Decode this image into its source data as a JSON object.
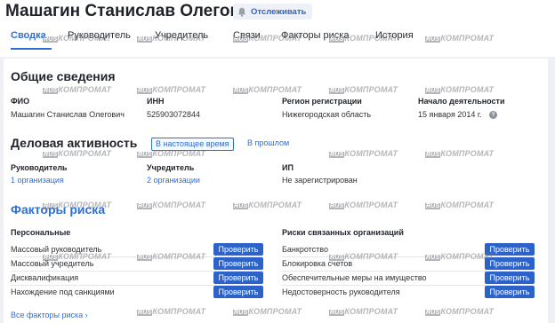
{
  "header": {
    "title": "Машагин Станислав Олегович",
    "track_label": "Отслеживать"
  },
  "tabs": [
    {
      "label": "Сводка",
      "active": true
    },
    {
      "label": "Руководитель",
      "active": false
    },
    {
      "label": "Учредитель",
      "active": false
    },
    {
      "label": "Связи",
      "active": false
    },
    {
      "label": "Факторы риска",
      "active": false
    },
    {
      "label": "История",
      "active": false
    }
  ],
  "general": {
    "heading": "Общие сведения",
    "fio_label": "ФИО",
    "fio_value": "Машагин Станислав Олегович",
    "inn_label": "ИНН",
    "inn_value": "525903072844",
    "region_label": "Регион регистрации",
    "region_value": "Нижегородская область",
    "start_label": "Начало деятельности",
    "start_value": "15 января 2014 г."
  },
  "activity": {
    "heading": "Деловая активность",
    "toggle_now": "В настоящее время",
    "toggle_past": "В прошлом",
    "director_label": "Руководитель",
    "director_value": "1 организация",
    "founder_label": "Учредитель",
    "founder_value": "2 организации",
    "ip_label": "ИП",
    "ip_value": "Не зарегистрирован"
  },
  "risks": {
    "heading": "Факторы риска",
    "personal_label": "Персональные",
    "related_label": "Риски связанных организаций",
    "check_label": "Проверить",
    "personal": [
      "Массовый руководитель",
      "Массовый учредитель",
      "Дисквалификация",
      "Нахождение под санкциями"
    ],
    "related": [
      "Банкротство",
      "Блокировка счетов",
      "Обеспечительные меры на имущество",
      "Недостоверность руководителя"
    ],
    "all_link": "Все факторы риска"
  },
  "watermark": {
    "part_a": "RUS",
    "part_b": "КОМПРОМАТ"
  },
  "colors": {
    "accent": "#2d6fd6",
    "button": "#2d63c8",
    "background": "#eef0f3"
  }
}
